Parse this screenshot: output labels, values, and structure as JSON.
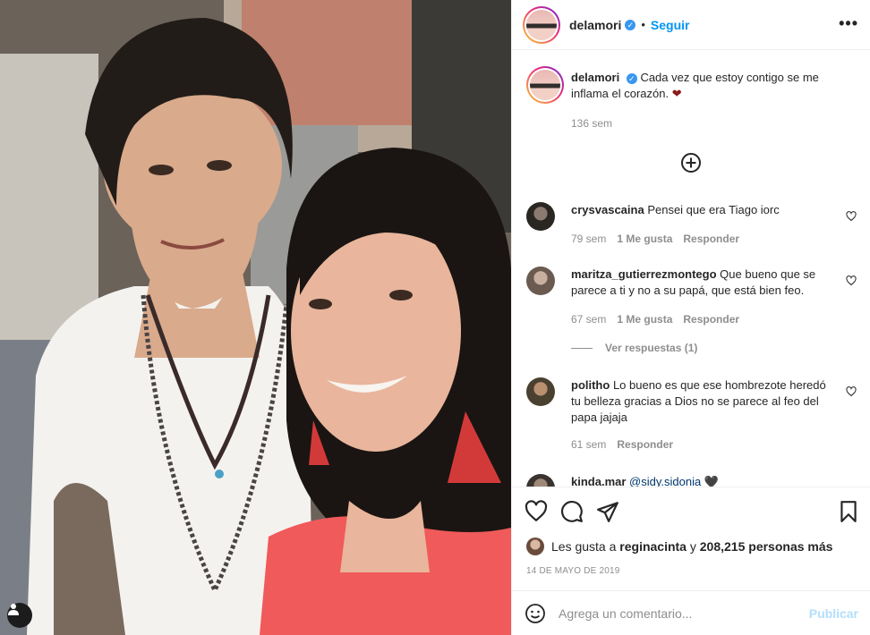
{
  "header": {
    "username": "delamori",
    "verified_icon": "verified-badge-icon",
    "separator": "•",
    "follow_label": "Seguir",
    "more_icon": "more-options-icon",
    "more_glyph": "•••"
  },
  "caption": {
    "username": "delamori",
    "text": "Cada vez que estoy contigo se me inflama el corazón.",
    "emoji": "❤",
    "time": "136 sem"
  },
  "load_more_icon": "plus-circle-icon",
  "comments": [
    {
      "username": "crysvascaina",
      "text": "Pensei que era Tiago iorc",
      "time": "79 sem",
      "likes": "1 Me gusta",
      "reply": "Responder"
    },
    {
      "username": "maritza_gutierrezmontego",
      "text": "Que bueno que se parece a ti y no a su papá, que está bien feo.",
      "time": "67 sem",
      "likes": "1 Me gusta",
      "reply": "Responder"
    },
    {
      "username": "politho",
      "text": "Lo bueno es que ese hombrezote heredó tu belleza gracias a Dios no se parece al feo del papa jajaja",
      "time": "61 sem",
      "reply": "Responder"
    },
    {
      "username": "kinda.mar",
      "text": "@sidy.sidonia 🖤"
    }
  ],
  "view_replies": "Ver respuestas (1)",
  "actions": {
    "like_icon": "heart-icon",
    "comment_icon": "comment-icon",
    "share_icon": "share-icon",
    "save_icon": "bookmark-icon"
  },
  "likes": {
    "prefix": "Les gusta a",
    "user": "reginacinta",
    "connector": "y",
    "count": "208,215 personas más"
  },
  "date": "14 DE MAYO DE 2019",
  "add_comment": {
    "emoji_icon": "emoji-icon",
    "placeholder": "Agrega un comentario...",
    "publish_label": "Publicar"
  },
  "colors": {
    "accent": "#0095f6",
    "verified": "#3897f0",
    "muted": "#8e8e8e",
    "heart": "#8b1a1a",
    "publish_disabled": "#b2dffc"
  }
}
